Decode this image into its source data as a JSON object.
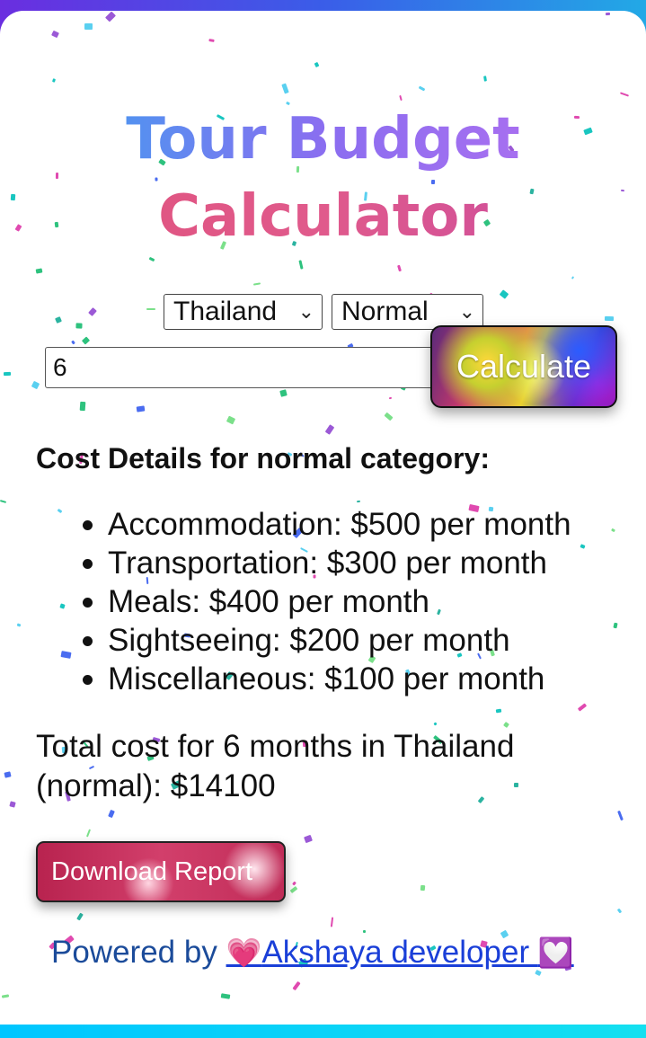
{
  "app": {
    "title_line1": "Tour Budget",
    "title_line2": "Calculator"
  },
  "form": {
    "country_selected": "Thailand",
    "category_selected": "Normal",
    "months_value": "6",
    "calculate_label": "Calculate"
  },
  "results": {
    "heading": "Cost Details for normal category:",
    "items": [
      "Accommodation: $500 per month",
      "Transportation: $300 per month",
      "Meals: $400 per month",
      "Sightseeing: $200 per month",
      "Miscellaneous: $100 per month"
    ],
    "total_text": "Total cost for 6 months in Thailand (normal): $14100"
  },
  "actions": {
    "download_label": "Download Report"
  },
  "footer": {
    "powered_prefix": "Powered by ",
    "heart_left": "💗",
    "developer_name": "Akshaya developer ",
    "heart_right": "💟"
  },
  "colors": {
    "page_background": "#ffffff",
    "download_button": "#d23f6b",
    "title_blue": "#31a8f0",
    "title_pink": "#e0517a",
    "link": "#1a3fd8"
  },
  "icons": {
    "select_arrow": "chevron-down-icon"
  }
}
